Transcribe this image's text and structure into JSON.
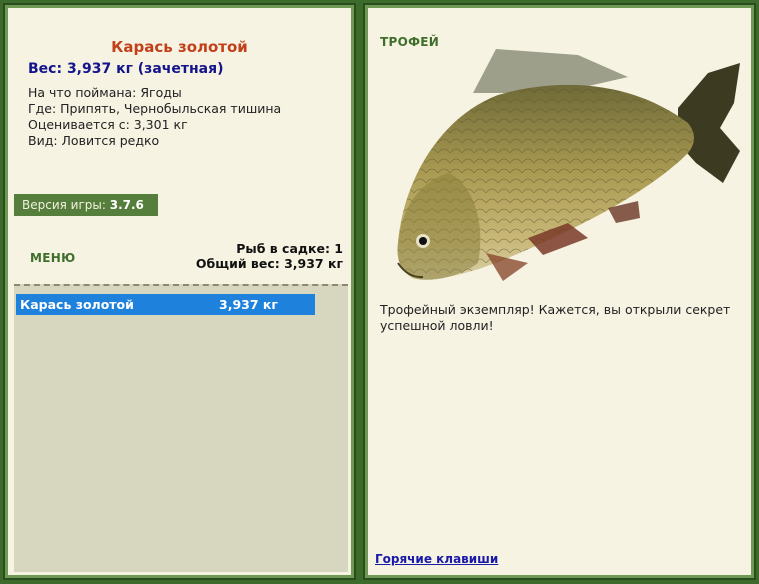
{
  "fish": {
    "title": "Карась золотой",
    "weight_line": "Вес: 3,937 кг (зачетная)",
    "bait": "На что поймана: Ягоды",
    "place": "Где: Припять, Чернобыльская тишина",
    "price": "Оценивается с: 3,301 кг",
    "kind": "Вид: Ловится редко"
  },
  "version": {
    "label": "Версия игры:",
    "value": "3.7.6"
  },
  "menu": {
    "label": "МЕНЮ"
  },
  "stats": {
    "count_line": "Рыб в садке: 1",
    "total_line": "Общий вес: 3,937 кг"
  },
  "creel": {
    "items": [
      {
        "name": "Карась золотой",
        "weight": "3,937 кг"
      }
    ]
  },
  "trophy": {
    "label": "ТРОФЕЙ",
    "text": "Трофейный экземпляр! Кажется, вы открыли секрет успешной ловли!"
  },
  "hotkeys": {
    "label": "Горячие клавиши"
  },
  "colors": {
    "frame": "#3d6b2b",
    "panel": "#f6f3e3",
    "title": "#c2401a",
    "weight": "#14148c",
    "menu": "#3f6e2b",
    "selection": "#1e82dc",
    "creel_bg": "#d7d7bf"
  }
}
